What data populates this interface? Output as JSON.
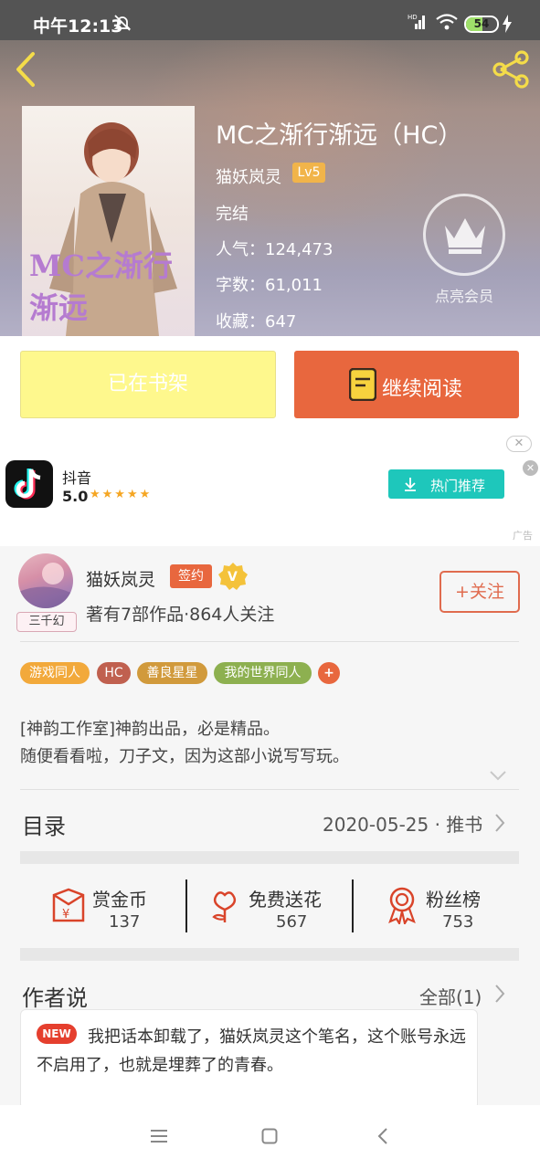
{
  "status_bar": {
    "time": "中午12:13",
    "battery": "54"
  },
  "book": {
    "title": "MC之渐行渐远（HC）",
    "author": "猫妖岚灵",
    "author_level": "Lv5",
    "status": "完结",
    "popularity": "人气：124,473",
    "word_count": "字数：61,011",
    "favorites": "收藏：647",
    "cover_text": "MC之渐行渐远",
    "member_label": "点亮会员"
  },
  "actions": {
    "shelf_label": "已在书架",
    "read_label": "继续阅读"
  },
  "ad": {
    "app_name": "抖音",
    "rating": "5.0",
    "stars": "★★★★★",
    "button_label": "热门推荐",
    "tag": "广告"
  },
  "author_card": {
    "name": "猫妖岚灵",
    "sign_badge": "签约",
    "badge": "三千幻",
    "summary": "著有7部作品·864人关注",
    "follow_label": "+关注"
  },
  "tags": [
    {
      "label": "游戏同人",
      "color": "#f2a93b"
    },
    {
      "label": "HC",
      "color": "#c0604f"
    },
    {
      "label": "善良星星",
      "color": "#d19a3c"
    },
    {
      "label": "我的世界同人",
      "color": "#8db050"
    },
    {
      "label": "+",
      "color": "#e8673e"
    }
  ],
  "description": {
    "line1": "[神韵工作室]神韵出品，必是精品。",
    "line2": "随便看看啦，刀子文，因为这部小说写写玩。"
  },
  "catalog": {
    "title": "目录",
    "meta": "2020-05-25 · 推书"
  },
  "stats": [
    {
      "label": "赏金币",
      "value": "137"
    },
    {
      "label": "免费送花",
      "value": "567"
    },
    {
      "label": "粉丝榜",
      "value": "753"
    }
  ],
  "author_says": {
    "title": "作者说",
    "all_label": "全部(1)",
    "new_badge": "NEW",
    "text": "我把话本卸载了，猫妖岚灵这个笔名，这个账号永远不启用了，也就是埋葬了的青春。"
  },
  "colors": {
    "accent": "#e8673e",
    "shelf_yellow": "#fef88d",
    "teal": "#1ec7bb",
    "level": "#f1b44a"
  }
}
